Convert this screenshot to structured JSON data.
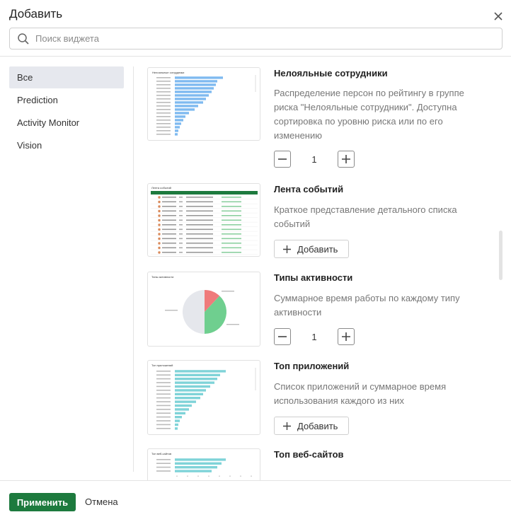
{
  "dialog": {
    "title": "Добавить",
    "search_placeholder": "Поиск виджета"
  },
  "sidebar": {
    "items": [
      {
        "label": "Все",
        "active": true
      },
      {
        "label": "Prediction",
        "active": false
      },
      {
        "label": "Activity Monitor",
        "active": false
      },
      {
        "label": "Vision",
        "active": false
      }
    ]
  },
  "widgets": [
    {
      "title": "Нелояльные сотрудники",
      "description": "Распределение персон по рейтингу в группе риска \"Нелояльные сотрудники\". Доступна сортировка по уровню риска или по его изменению",
      "control": "stepper",
      "count": "1",
      "thumb": {
        "title": "Нелояльные сотрудники",
        "bars": [
          0.68,
          0.6,
          0.58,
          0.55,
          0.52,
          0.48,
          0.44,
          0.4,
          0.33,
          0.28,
          0.2,
          0.15,
          0.12,
          0.09,
          0.07,
          0.05,
          0.04
        ]
      }
    },
    {
      "title": "Лента событий",
      "description": "Краткое представление детального списка событий",
      "control": "add",
      "add_label": "Добавить",
      "thumb": {
        "title": "Лента событий",
        "rows": 13
      }
    },
    {
      "title": "Типы активности",
      "description": "Суммарное время работы по каждому типу активности",
      "control": "stepper",
      "count": "1",
      "thumb": {
        "title": "Типы активности",
        "slices": [
          {
            "value": 0.12,
            "color": "#ef7b7b"
          },
          {
            "value": 0.38,
            "color": "#6fcf8f"
          },
          {
            "value": 0.5,
            "color": "#e5e7ec"
          }
        ]
      }
    },
    {
      "title": "Топ приложений",
      "description": "Список приложений и суммарное время использования каждого из них",
      "control": "add",
      "add_label": "Добавить",
      "thumb": {
        "title": "Топ приложений",
        "bars": [
          0.72,
          0.64,
          0.6,
          0.56,
          0.5,
          0.44,
          0.4,
          0.36,
          0.3,
          0.24,
          0.2,
          0.15,
          0.1,
          0.07,
          0.05,
          0.04
        ]
      }
    },
    {
      "title": "Топ веб-сайтов",
      "thumb": {
        "title": "Топ веб-сайтов",
        "bars": [
          0.72,
          0.66,
          0.6,
          0.52
        ]
      }
    }
  ],
  "footer": {
    "apply_label": "Применить",
    "cancel_label": "Отмена"
  },
  "colors": {
    "accent_green": "#1d7a3e",
    "sidebar_active": "#e6e8ee",
    "bar_blue": "#7fbaf0",
    "bar_teal": "#7fd3d8",
    "pie_red": "#ef7b7b",
    "pie_green": "#6fcf8f",
    "pie_grey": "#e5e7ec"
  }
}
